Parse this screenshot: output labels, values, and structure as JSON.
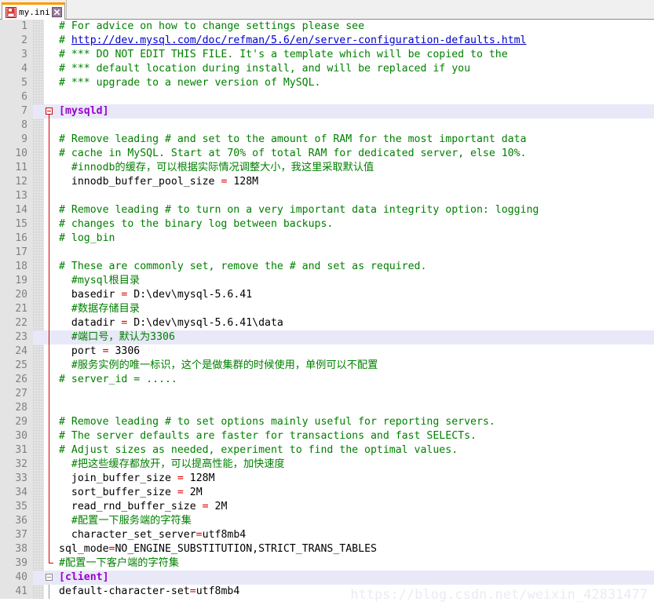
{
  "window": {
    "app": "notepad-plus-plus"
  },
  "tabbar": {
    "tabs": [
      {
        "label": "my.ini",
        "icon": "floppy-disk-unsaved-icon",
        "close_icon": "close-icon",
        "active": true,
        "modified": true
      }
    ]
  },
  "editor": {
    "current_line": 23,
    "gutter": {
      "first_line": 1,
      "last_line": 41
    },
    "watermark": "https://blog.csdn.net/weixin_42831477",
    "colors": {
      "comment": "#008000",
      "section": "#9900cc",
      "operator": "#dd0000",
      "link": "#0000cc",
      "text": "#000000",
      "background": "#ffffff",
      "line_number": "#808080",
      "gutter_background": "#e4e4e4",
      "current_line_background": "#e8e8f8",
      "fold_marker": "#d00000",
      "tab_active_accent": "#ff9900"
    },
    "lines": [
      {
        "n": 1,
        "text": "# For advice on how to change settings please see"
      },
      {
        "n": 2,
        "text": "# http://dev.mysql.com/doc/refman/5.6/en/server-configuration-defaults.html"
      },
      {
        "n": 3,
        "text": "# *** DO NOT EDIT THIS FILE. It's a template which will be copied to the"
      },
      {
        "n": 4,
        "text": "# *** default location during install, and will be replaced if you"
      },
      {
        "n": 5,
        "text": "# *** upgrade to a newer version of MySQL."
      },
      {
        "n": 6,
        "text": ""
      },
      {
        "n": 7,
        "text": "[mysqld]"
      },
      {
        "n": 8,
        "text": ""
      },
      {
        "n": 9,
        "text": "# Remove leading # and set to the amount of RAM for the most important data"
      },
      {
        "n": 10,
        "text": "# cache in MySQL. Start at 70% of total RAM for dedicated server, else 10%."
      },
      {
        "n": 11,
        "text": "  #innodb的缓存，可以根据实际情况调整大小，我这里采取默认值"
      },
      {
        "n": 12,
        "text": "  innodb_buffer_pool_size = 128M"
      },
      {
        "n": 13,
        "text": ""
      },
      {
        "n": 14,
        "text": "# Remove leading # to turn on a very important data integrity option: logging"
      },
      {
        "n": 15,
        "text": "# changes to the binary log between backups."
      },
      {
        "n": 16,
        "text": "# log_bin"
      },
      {
        "n": 17,
        "text": ""
      },
      {
        "n": 18,
        "text": "# These are commonly set, remove the # and set as required."
      },
      {
        "n": 19,
        "text": "  #mysql根目录"
      },
      {
        "n": 20,
        "text": "  basedir = D:\\dev\\mysql-5.6.41"
      },
      {
        "n": 21,
        "text": "  #数据存储目录"
      },
      {
        "n": 22,
        "text": "  datadir = D:\\dev\\mysql-5.6.41\\data"
      },
      {
        "n": 23,
        "text": "  #端口号，默认为3306"
      },
      {
        "n": 24,
        "text": "  port = 3306"
      },
      {
        "n": 25,
        "text": "  #服务实例的唯一标识，这个是做集群的时候使用，单例可以不配置"
      },
      {
        "n": 26,
        "text": "# server_id = ....."
      },
      {
        "n": 27,
        "text": ""
      },
      {
        "n": 28,
        "text": ""
      },
      {
        "n": 29,
        "text": "# Remove leading # to set options mainly useful for reporting servers."
      },
      {
        "n": 30,
        "text": "# The server defaults are faster for transactions and fast SELECTs."
      },
      {
        "n": 31,
        "text": "# Adjust sizes as needed, experiment to find the optimal values."
      },
      {
        "n": 32,
        "text": "  #把这些缓存都放开，可以提高性能，加快速度"
      },
      {
        "n": 33,
        "text": "  join_buffer_size = 128M"
      },
      {
        "n": 34,
        "text": "  sort_buffer_size = 2M"
      },
      {
        "n": 35,
        "text": "  read_rnd_buffer_size = 2M"
      },
      {
        "n": 36,
        "text": "  #配置一下服务端的字符集"
      },
      {
        "n": 37,
        "text": "  character_set_server=utf8mb4"
      },
      {
        "n": 38,
        "text": "sql_mode=NO_ENGINE_SUBSTITUTION,STRICT_TRANS_TABLES"
      },
      {
        "n": 39,
        "text": "#配置一下客户端的字符集"
      },
      {
        "n": 40,
        "text": "[client]"
      },
      {
        "n": 41,
        "text": "default-character-set=utf8mb4"
      }
    ]
  }
}
